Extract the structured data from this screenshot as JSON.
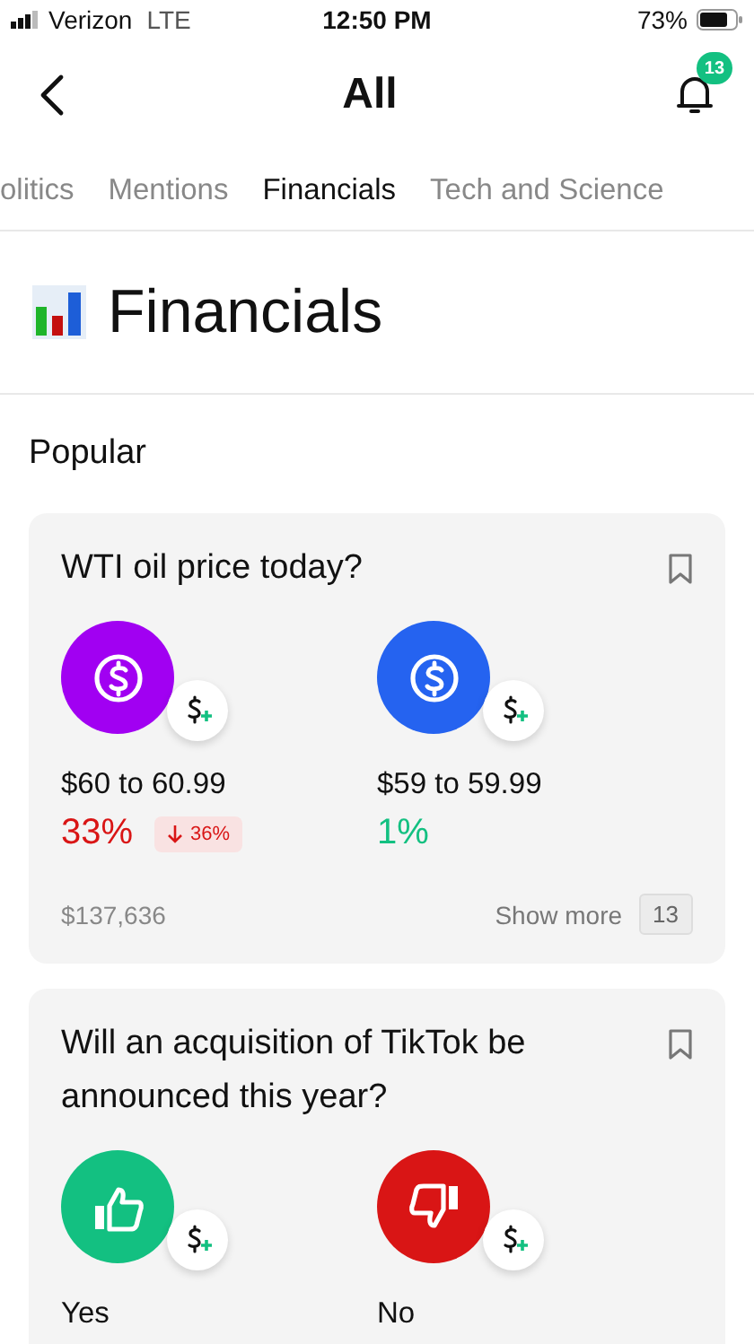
{
  "status_bar": {
    "carrier": "Verizon",
    "network": "LTE",
    "time": "12:50 PM",
    "battery": "73%"
  },
  "nav": {
    "title": "All",
    "notification_count": "13"
  },
  "tabs": [
    {
      "label": "olitics",
      "selected": false
    },
    {
      "label": "Mentions",
      "selected": false
    },
    {
      "label": "Financials",
      "selected": true
    },
    {
      "label": "Tech and Science",
      "selected": false
    }
  ],
  "header": {
    "title": "Financials"
  },
  "section": {
    "title": "Popular"
  },
  "cards": [
    {
      "question": "WTI oil price today?",
      "bookmarked": false,
      "options": [
        {
          "kind": "dollar",
          "color": "#a100f2",
          "label": "$60 to 60.99",
          "percent": "33%",
          "falling": true,
          "change": "36%"
        },
        {
          "kind": "dollar",
          "color": "#2563f0",
          "label": "$59 to 59.99",
          "percent": "1%",
          "falling": false
        }
      ],
      "volume": "$137,636",
      "show_more": "Show more",
      "more_count": "13"
    },
    {
      "question": "Will an acquisition of TikTok be announced this year?",
      "bookmarked": false,
      "options": [
        {
          "kind": "thumbs_up",
          "color": "#13c081",
          "label": "Yes"
        },
        {
          "kind": "thumbs_down",
          "color": "#d91515",
          "label": "No"
        }
      ]
    }
  ]
}
